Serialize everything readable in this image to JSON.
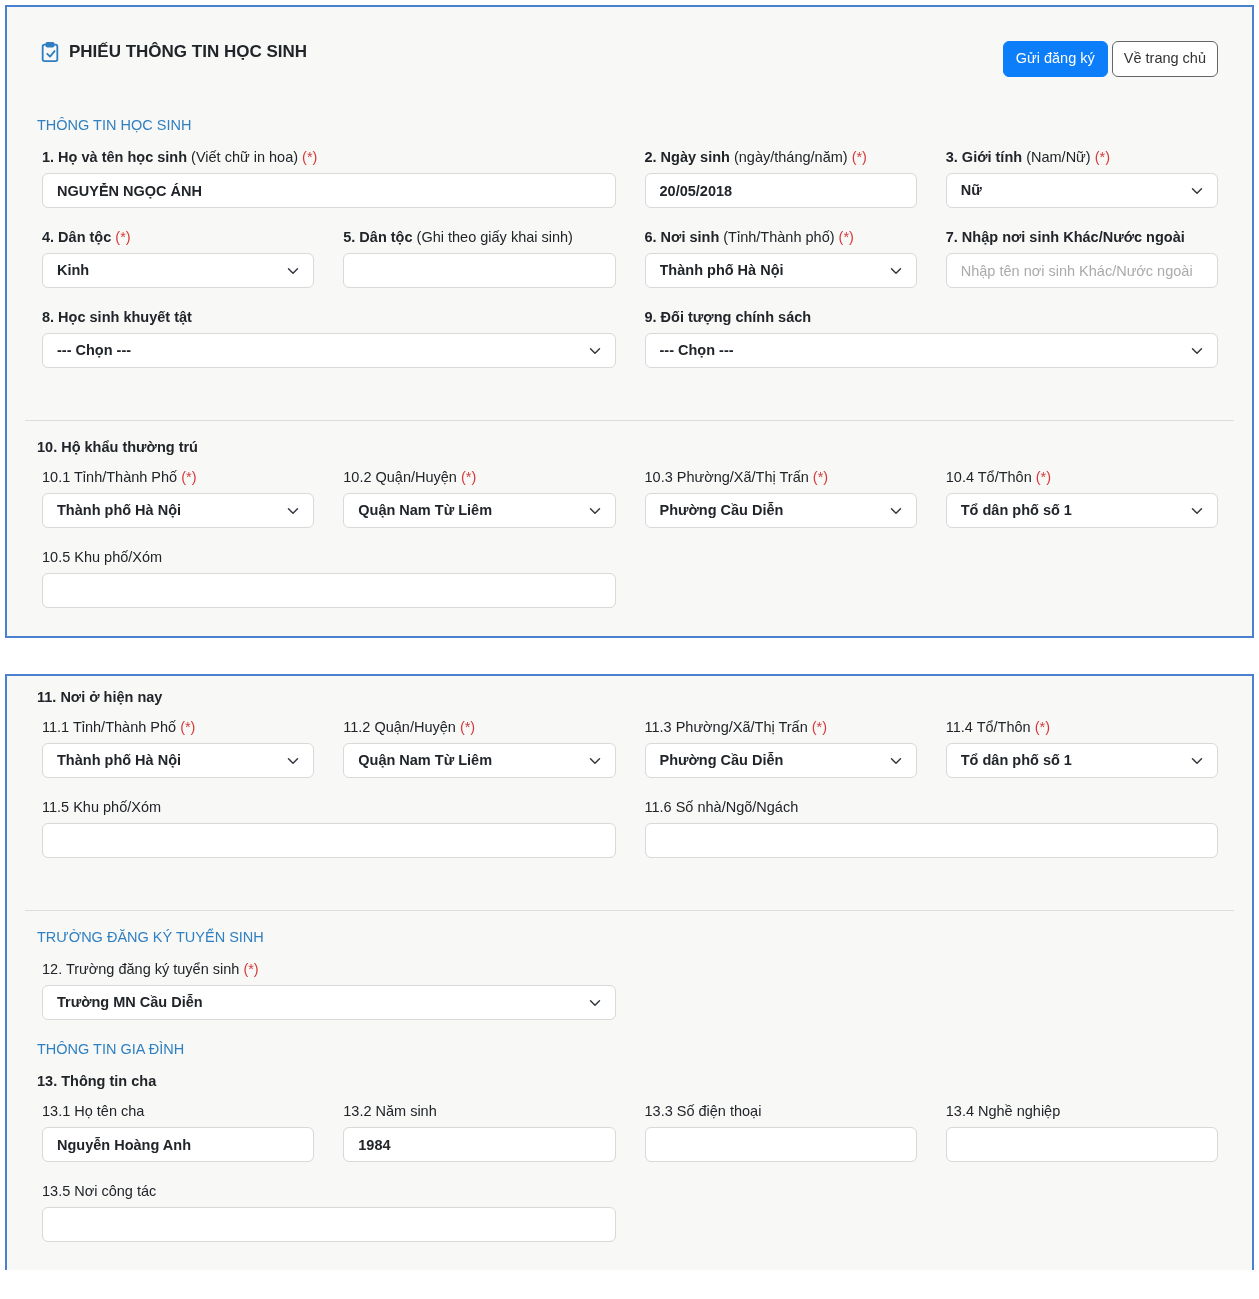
{
  "panels": [
    {
      "title": "PHIẾU THÔNG TIN HỌC SINH",
      "buttons": [
        {
          "label": "Gửi đăng ký",
          "kind": "primary"
        },
        {
          "label": "Về trang chủ",
          "kind": "secondary"
        }
      ],
      "blocks": [
        {
          "kind": "section",
          "text": "THÔNG TIN HỌC SINH"
        },
        {
          "kind": "fields",
          "fields": [
            {
              "label": "**1. Họ và tên học sinh** (Viết chữ in hoa)",
              "mark": "(*)",
              "kind": "text",
              "value": "NGUYỄN NGỌC ÁNH"
            },
            {
              "label": "**2. Ngày sinh** (ngày/tháng/năm)",
              "mark": "(*)",
              "kind": "text",
              "value": "20/05/2018"
            },
            {
              "label": "**3. Giới tính** (Nam/Nữ)",
              "mark": "(*)",
              "kind": "select",
              "value": "Nữ"
            }
          ]
        },
        {
          "kind": "fields",
          "fields": [
            {
              "label": "4. Dân tộc",
              "label_bold": true,
              "mark": "(*)",
              "kind": "select",
              "value": "Kinh"
            },
            {
              "label": "**5. Dân tộc** (Ghi theo giấy khai sinh)",
              "kind": "text"
            },
            {
              "label": "**6. Nơi sinh** (Tỉnh/Thành phố)",
              "mark": "(*)",
              "kind": "select",
              "value": "Thành phố Hà Nội"
            },
            {
              "label": "7. Nhập nơi sinh Khác/Nước ngoài",
              "label_bold": true,
              "kind": "text",
              "placeholder": "Nhập tên nơi sinh Khác/Nước ngoài"
            }
          ]
        },
        {
          "kind": "fields",
          "fields": [
            {
              "label": "8. Học sinh khuyết tật",
              "label_bold": true,
              "kind": "select",
              "value": "--- Chọn ---"
            },
            {
              "label": "9. Đối tượng chính sách",
              "label_bold": true,
              "kind": "select",
              "value": "--- Chọn ---"
            }
          ]
        },
        {
          "kind": "divider"
        },
        {
          "kind": "group",
          "text": "10. Hộ khẩu thường trú"
        },
        {
          "kind": "fields",
          "fields": [
            {
              "label": "10.1 Tỉnh/Thành Phố",
              "mark": "(*)",
              "kind": "select",
              "value": "Thành phố Hà Nội"
            },
            {
              "label": "10.2 Quận/Huyện",
              "mark": "(*)",
              "kind": "select",
              "value": "Quận Nam Từ Liêm"
            },
            {
              "label": "10.3 Phường/Xã/Thị Trấn",
              "mark": "(*)",
              "kind": "select",
              "value": "Phường Cầu Diễn"
            },
            {
              "label": "10.4 Tổ/Thôn",
              "mark": "(*)",
              "kind": "select",
              "value": "Tổ dân phố số 1"
            }
          ]
        },
        {
          "kind": "fields",
          "fields": [
            {
              "label": "10.5 Khu phố/Xóm",
              "kind": "text"
            }
          ]
        }
      ]
    },
    {
      "blocks": [
        {
          "kind": "group",
          "text": "11. Nơi ở hiện nay"
        },
        {
          "kind": "fields",
          "fields": [
            {
              "label": "11.1 Tỉnh/Thành Phố",
              "mark": "(*)",
              "kind": "select",
              "value": "Thành phố Hà Nội"
            },
            {
              "label": "11.2 Quận/Huyện",
              "mark": "(*)",
              "kind": "select",
              "value": "Quận Nam Từ Liêm"
            },
            {
              "label": "11.3 Phường/Xã/Thị Trấn",
              "mark": "(*)",
              "kind": "select",
              "value": "Phường Cầu Diễn"
            },
            {
              "label": "11.4 Tổ/Thôn",
              "mark": "(*)",
              "kind": "select",
              "value": "Tổ dân phố số 1"
            }
          ]
        },
        {
          "kind": "fields",
          "fields": [
            {
              "label": "11.5 Khu phố/Xóm",
              "kind": "text"
            },
            {
              "label": "11.6 Số nhà/Ngõ/Ngách",
              "kind": "text"
            }
          ]
        },
        {
          "kind": "divider"
        },
        {
          "kind": "section",
          "text": "TRƯỜNG ĐĂNG KÝ TUYỂN SINH"
        },
        {
          "kind": "fields",
          "fields": [
            {
              "label": "12. Trường đăng ký tuyển sinh",
              "mark": "(*)",
              "kind": "select",
              "value": "Trường MN Cầu Diễn"
            }
          ]
        },
        {
          "kind": "section",
          "text": "THÔNG TIN GIA ĐÌNH"
        },
        {
          "kind": "group",
          "text": "13. Thông tin cha"
        },
        {
          "kind": "fields",
          "fields": [
            {
              "label": "13.1 Họ tên cha",
              "kind": "text",
              "value": "Nguyễn Hoàng Anh"
            },
            {
              "label": "13.2 Năm sinh",
              "kind": "text",
              "value": "1984"
            },
            {
              "label": "13.3 Số điện thoại",
              "kind": "text"
            },
            {
              "label": "13.4 Nghề nghiệp",
              "kind": "text"
            }
          ]
        },
        {
          "kind": "fields",
          "fields": [
            {
              "label": "13.5 Nơi công tác",
              "kind": "text"
            }
          ]
        }
      ]
    }
  ]
}
